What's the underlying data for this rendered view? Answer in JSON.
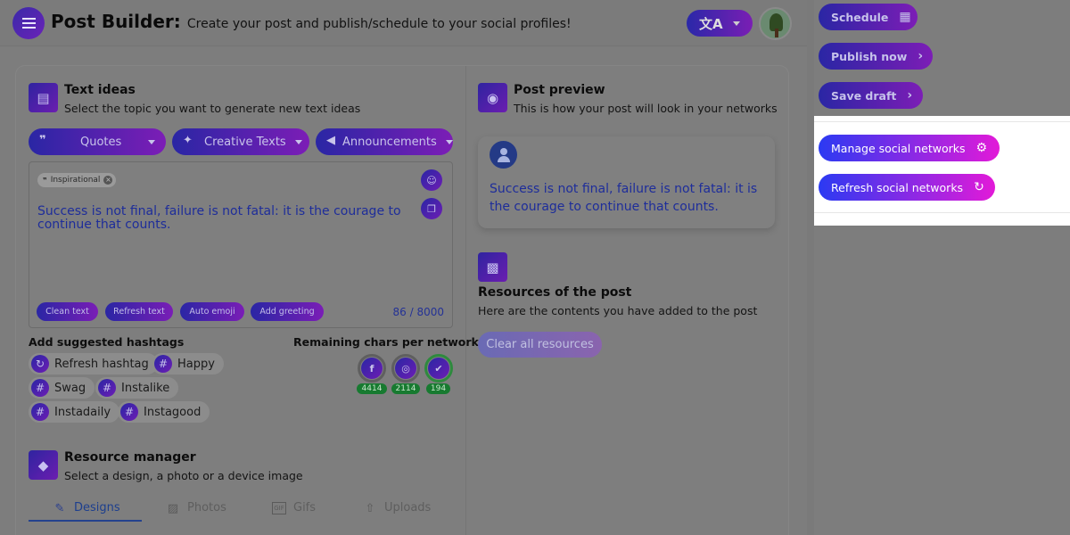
{
  "header": {
    "title": "Post Builder:",
    "subtitle": "Create your post and publish/schedule to your social profiles!",
    "lang_icon": "translate-icon"
  },
  "text_ideas": {
    "title": "Text ideas",
    "subtitle": "Select the topic you want to generate new text ideas",
    "categories": [
      {
        "label": "Quotes",
        "icon": "quote-icon"
      },
      {
        "label": "Creative Texts",
        "icon": "sparkle-icon"
      },
      {
        "label": "Announcements",
        "icon": "megaphone-icon"
      }
    ],
    "chip": "Inspirational",
    "text": "Success is not final, failure is not fatal: it is the courage to continue that counts.",
    "actions": [
      "Clean text",
      "Refresh text",
      "Auto emoji",
      "Add greeting"
    ],
    "counter": "86 / 8000"
  },
  "hashtags": {
    "title": "Add suggested hashtags",
    "refresh_label": "Refresh hashtag",
    "tags": [
      "Happy",
      "Swag",
      "Instalike",
      "Instadaily",
      "Instagood"
    ]
  },
  "remaining": {
    "title": "Remaining chars per network",
    "networks": [
      {
        "name": "facebook",
        "count": "4414"
      },
      {
        "name": "instagram",
        "count": "2114"
      },
      {
        "name": "twitter",
        "count": "194"
      }
    ]
  },
  "resource_manager": {
    "title": "Resource manager",
    "subtitle": "Select a design, a photo or a device image",
    "tabs": [
      "Designs",
      "Photos",
      "Gifs",
      "Uploads"
    ],
    "active_tab": "Designs"
  },
  "preview": {
    "title": "Post preview",
    "subtitle": "This is how your post will look in your networks",
    "text": "Success is not final, failure is not fatal: it is the courage to continue that counts."
  },
  "resources": {
    "title": "Resources of the post",
    "subtitle": "Here are the contents you have added to the post",
    "clear_label": "Clear all resources"
  },
  "sidebar": {
    "schedule": "Schedule",
    "publish": "Publish now",
    "save_draft": "Save draft",
    "manage": "Manage social networks",
    "refresh": "Refresh social networks"
  },
  "colors": {
    "accent_start": "#2b3af2",
    "accent_end": "#e21ad8",
    "text_blue": "#1e2d9a",
    "count_green": "#177a30"
  }
}
